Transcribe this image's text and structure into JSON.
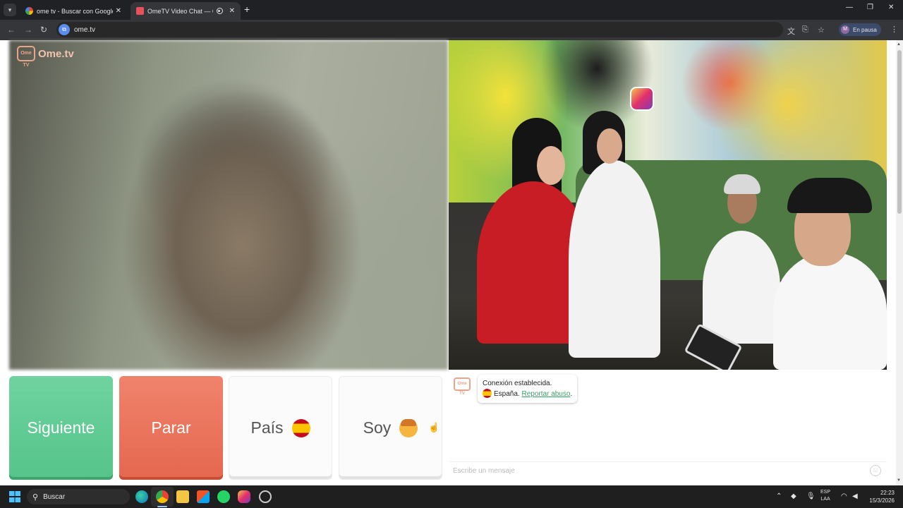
{
  "browser": {
    "tabs": [
      {
        "title": "ome tv - Buscar con Google",
        "favicon": "google-icon"
      },
      {
        "title": "OmeTV Video Chat — Ome",
        "favicon": "ometv-icon",
        "active": true
      }
    ],
    "url": "ome.tv",
    "profile_initial": "M",
    "profile_status": "En pausa"
  },
  "page": {
    "logo_text": "Ome.tv",
    "logo_mark": "Ome TV",
    "buttons": {
      "next": "Siguiente",
      "stop": "Parar",
      "country": "País",
      "gender": "Soy"
    },
    "chat": {
      "connection": "Conexión establecida.",
      "country": "España.",
      "report_link": "Reportar abuso",
      "report_suffix": ".",
      "input_placeholder": "Escribe un mensaje"
    }
  },
  "taskbar": {
    "search_placeholder": "Buscar",
    "lang_top": "ESP",
    "lang_bottom": "LAA",
    "time": "22:23",
    "date": "15/3/2026"
  },
  "colors": {
    "next": "#55c48a",
    "stop": "#e5674f",
    "link": "#3a9d6a",
    "browser_bg": "#202124"
  }
}
